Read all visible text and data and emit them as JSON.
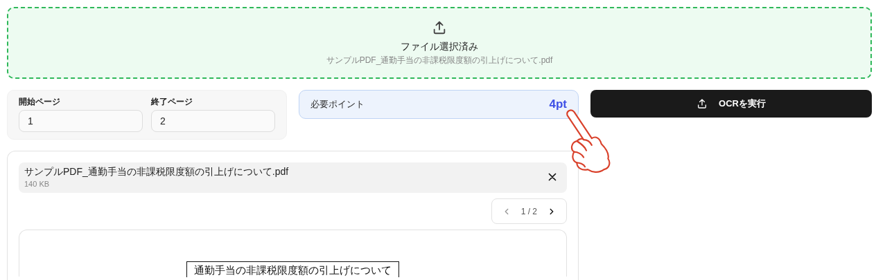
{
  "upload": {
    "title": "ファイル選択済み",
    "filename": "サンプルPDF_通勤手当の非課税限度額の引上げについて.pdf",
    "selected": true
  },
  "page_range": [
    {
      "label": "開始ページ",
      "value": "1"
    },
    {
      "label": "終了ページ",
      "value": "2"
    }
  ],
  "points": {
    "label": "必要ポイント",
    "value": "4pt"
  },
  "run_button": {
    "label": "OCRを実行"
  },
  "file": {
    "name": "サンプルPDF_通勤手当の非課税限度額の引上げについて.pdf",
    "size": "140 KB"
  },
  "pager": {
    "text": "1 / 2",
    "prev_disabled": true,
    "next_disabled": false
  },
  "preview": {
    "title": "通勤手当の非課税限度額の引上げについて"
  }
}
